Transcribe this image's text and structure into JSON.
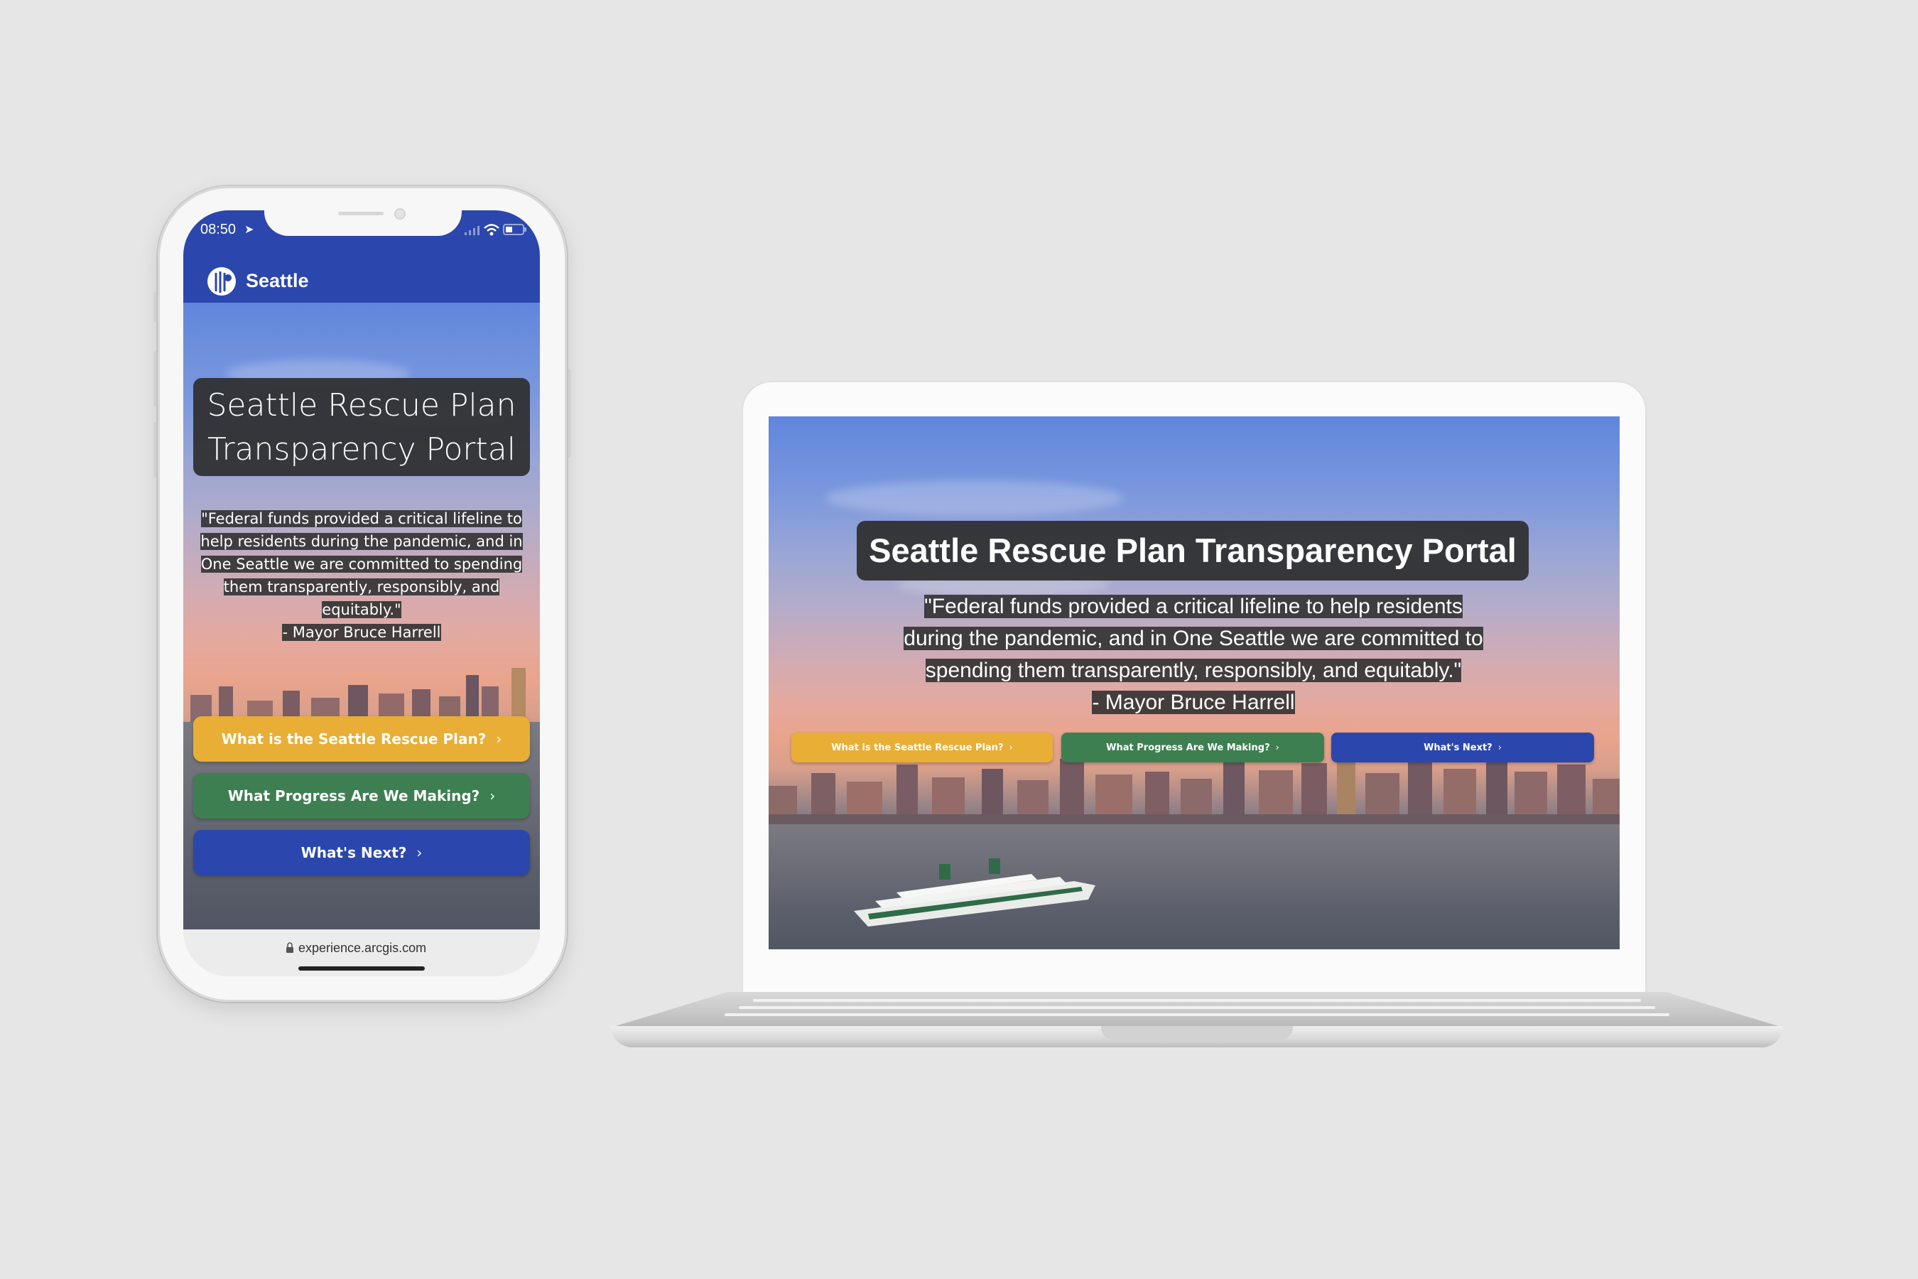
{
  "phone": {
    "status_time": "08:50",
    "header_title": "Seattle",
    "hero_title": "Seattle Rescue Plan Transparency Portal",
    "quote_lines": [
      "\"Federal funds provided a critical lifeline to",
      "help residents during the pandemic, and in",
      "One Seattle we are committed to spending",
      "them transparently, responsibly, and",
      "equitably.\"",
      "- Mayor Bruce Harrell"
    ],
    "buttons": [
      {
        "label": "What is the Seattle Rescue Plan?",
        "color": "#e8ae35"
      },
      {
        "label": "What Progress Are We Making?",
        "color": "#3d7f51"
      },
      {
        "label": "What's Next?",
        "color": "#2b47ad"
      }
    ],
    "url": "experience.arcgis.com"
  },
  "laptop": {
    "hero_title": "Seattle Rescue Plan Transparency Portal",
    "quote_lines": [
      "\"Federal funds provided a critical lifeline to help residents",
      "during the pandemic, and in One Seattle we are committed to",
      "spending them transparently, responsibly, and equitably.\"",
      "- Mayor Bruce Harrell"
    ],
    "buttons": [
      {
        "label": "What is the Seattle Rescue Plan?",
        "color": "#e8ae35"
      },
      {
        "label": "What Progress Are We Making?",
        "color": "#3d7f51"
      },
      {
        "label": "What's Next?",
        "color": "#2b47ad"
      }
    ]
  },
  "colors": {
    "header_blue": "#2b47ad",
    "background": "#e6e6e6"
  }
}
